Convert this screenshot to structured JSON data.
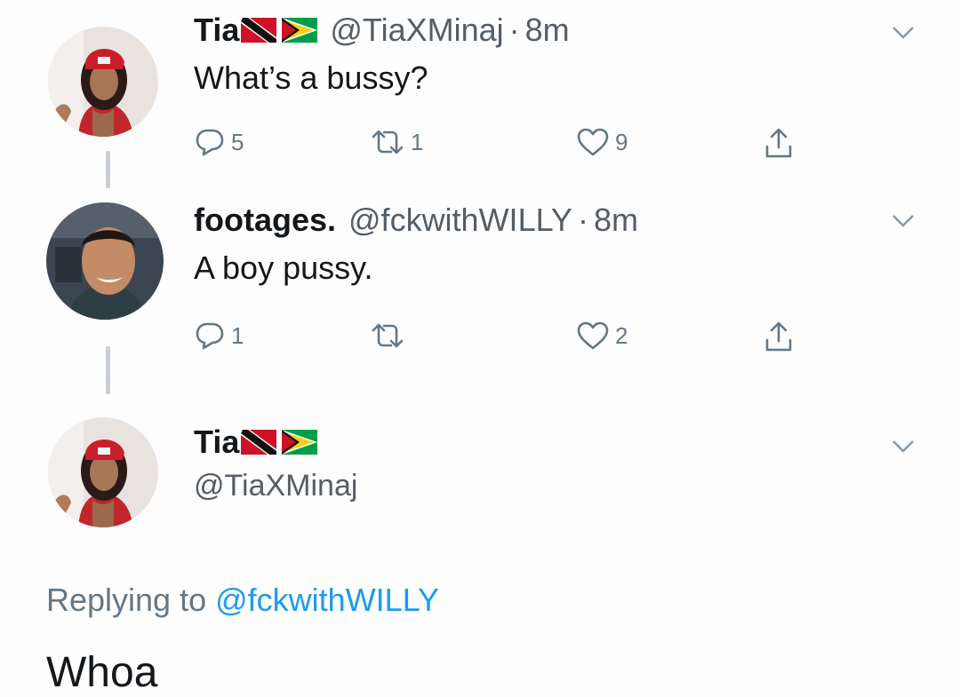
{
  "tweets": [
    {
      "name": "Tia",
      "handle": "@TiaXMinaj",
      "separator": "·",
      "time": "8m",
      "text": "What’s a bussy?",
      "replies": "5",
      "retweets": "1",
      "likes": "9"
    },
    {
      "name": "footages.",
      "handle": "@fckwithWILLY",
      "separator": "·",
      "time": "8m",
      "text": "A boy pussy.",
      "replies": "1",
      "retweets": "",
      "likes": "2"
    }
  ],
  "reply": {
    "name": "Tia",
    "handle": "@TiaXMinaj",
    "replying_prefix": "Replying to",
    "replying_to": "@fckwithWILLY",
    "text": "Whoa"
  },
  "icons": {
    "reply": "reply-icon",
    "retweet": "retweet-icon",
    "like": "heart-icon",
    "share": "share-icon",
    "more": "chevron-down-icon"
  },
  "colors": {
    "icon_gray": "#657786",
    "link_blue": "#1d9bf0",
    "text": "#14171a"
  }
}
